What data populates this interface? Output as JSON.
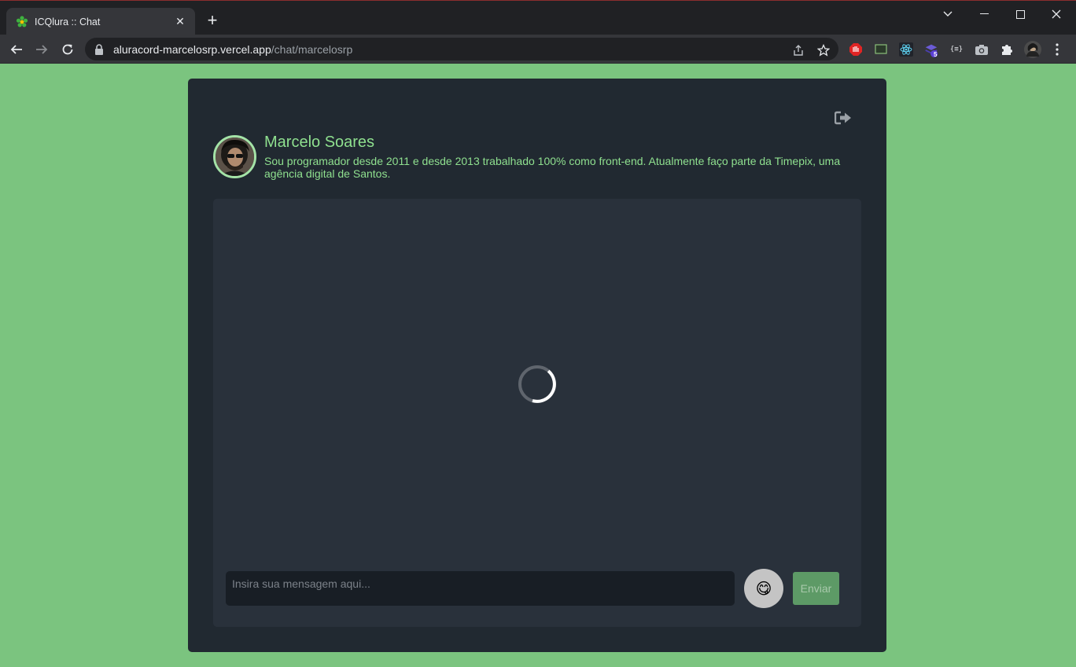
{
  "browser": {
    "tab": {
      "title": "ICQlura :: Chat",
      "favicon": "icq-flower-icon"
    },
    "url": {
      "domain": "aluracord-marcelosrp.vercel.app",
      "path": "/chat/marcelosrp"
    },
    "extensions": [
      {
        "name": "adblock-icon",
        "color": "#e02424"
      },
      {
        "name": "screen-extension-icon"
      },
      {
        "name": "react-devtools-icon",
        "color": "#61dafb"
      },
      {
        "name": "stack-extension-icon",
        "badge": "5"
      },
      {
        "name": "json-formatter-icon",
        "label": "{≡}"
      },
      {
        "name": "camera-icon"
      },
      {
        "name": "puzzle-extensions-icon"
      }
    ]
  },
  "profile": {
    "name": "Marcelo Soares",
    "bio": "Sou programador desde 2011 e desde 2013 trabalhado 100% como front-end. Atualmente faço parte da Timepix, uma agência digital de Santos."
  },
  "chat": {
    "loading": true,
    "input_placeholder": "Insira sua mensagem aqui...",
    "input_value": "",
    "emoji_button": "😋",
    "send_label": "Enviar"
  },
  "theme": {
    "background": "#7bc47f",
    "panel": "#212931",
    "chat_area": "#29313b",
    "accent_text": "#8fe08f",
    "send_button": "#5d9a66"
  }
}
